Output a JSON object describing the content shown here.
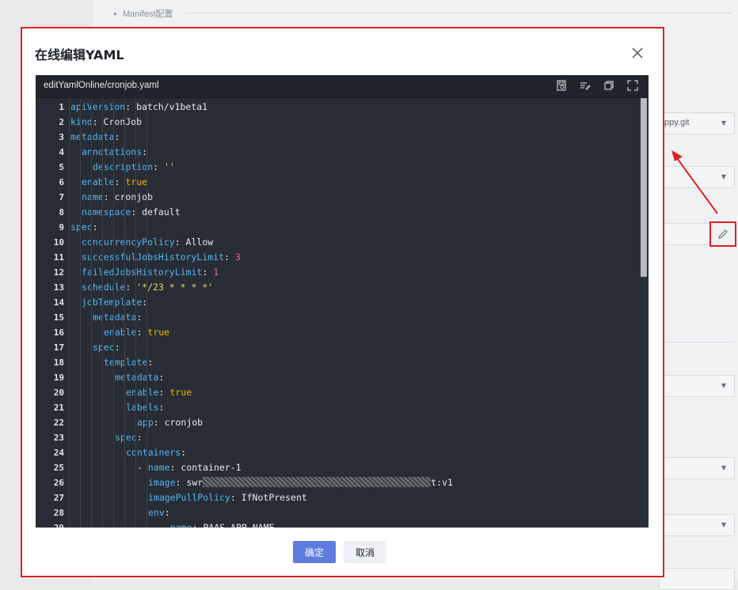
{
  "background": {
    "section_label": "Manifest配置",
    "repo_select_value": "ppy.git"
  },
  "dialog": {
    "title": "在线编辑YAML",
    "editor": {
      "filename": "editYamlOnline/cronjob.yaml",
      "tools": [
        "save-icon",
        "format-icon",
        "copy-icon",
        "fullscreen-icon"
      ],
      "line_numbers": [
        "1",
        "2",
        "3",
        "4",
        "5",
        "6",
        "7",
        "8",
        "9",
        "10",
        "11",
        "12",
        "13",
        "14",
        "15",
        "16",
        "17",
        "18",
        "19",
        "20",
        "21",
        "22",
        "23",
        "24",
        "25",
        "26",
        "27",
        "28",
        "29"
      ],
      "lines": [
        {
          "indent": 0,
          "tokens": [
            {
              "t": "k",
              "v": "apiVersion"
            },
            {
              "t": "p",
              "v": ": batch/v1beta1"
            }
          ]
        },
        {
          "indent": 0,
          "tokens": [
            {
              "t": "k",
              "v": "kind"
            },
            {
              "t": "p",
              "v": ": CronJob"
            }
          ]
        },
        {
          "indent": 0,
          "tokens": [
            {
              "t": "k",
              "v": "metadata"
            },
            {
              "t": "p",
              "v": ":"
            }
          ]
        },
        {
          "indent": 1,
          "tokens": [
            {
              "t": "k",
              "v": "annotations"
            },
            {
              "t": "p",
              "v": ":"
            }
          ]
        },
        {
          "indent": 2,
          "tokens": [
            {
              "t": "k",
              "v": "description"
            },
            {
              "t": "p",
              "v": ": "
            },
            {
              "t": "s",
              "v": "''"
            }
          ]
        },
        {
          "indent": 1,
          "tokens": [
            {
              "t": "k",
              "v": "enable"
            },
            {
              "t": "p",
              "v": ": "
            },
            {
              "t": "b",
              "v": "true"
            }
          ]
        },
        {
          "indent": 1,
          "tokens": [
            {
              "t": "k",
              "v": "name"
            },
            {
              "t": "p",
              "v": ": cronjob"
            }
          ]
        },
        {
          "indent": 1,
          "tokens": [
            {
              "t": "k",
              "v": "namespace"
            },
            {
              "t": "p",
              "v": ": default"
            }
          ]
        },
        {
          "indent": 0,
          "tokens": [
            {
              "t": "k",
              "v": "spec"
            },
            {
              "t": "p",
              "v": ":"
            }
          ]
        },
        {
          "indent": 1,
          "tokens": [
            {
              "t": "k",
              "v": "concurrencyPolicy"
            },
            {
              "t": "p",
              "v": ": Allow"
            }
          ]
        },
        {
          "indent": 1,
          "tokens": [
            {
              "t": "k",
              "v": "successfulJobsHistoryLimit"
            },
            {
              "t": "p",
              "v": ": "
            },
            {
              "t": "n",
              "v": "3"
            }
          ]
        },
        {
          "indent": 1,
          "tokens": [
            {
              "t": "k",
              "v": "failedJobsHistoryLimit"
            },
            {
              "t": "p",
              "v": ": "
            },
            {
              "t": "n",
              "v": "1"
            }
          ]
        },
        {
          "indent": 1,
          "tokens": [
            {
              "t": "k",
              "v": "schedule"
            },
            {
              "t": "p",
              "v": ": "
            },
            {
              "t": "s",
              "v": "'*/23 * * * *'"
            }
          ]
        },
        {
          "indent": 1,
          "tokens": [
            {
              "t": "k",
              "v": "jobTemplate"
            },
            {
              "t": "p",
              "v": ":"
            }
          ]
        },
        {
          "indent": 2,
          "tokens": [
            {
              "t": "k",
              "v": "metadata"
            },
            {
              "t": "p",
              "v": ":"
            }
          ]
        },
        {
          "indent": 3,
          "tokens": [
            {
              "t": "k",
              "v": "enable"
            },
            {
              "t": "p",
              "v": ": "
            },
            {
              "t": "b",
              "v": "true"
            }
          ]
        },
        {
          "indent": 2,
          "tokens": [
            {
              "t": "k",
              "v": "spec"
            },
            {
              "t": "p",
              "v": ":"
            }
          ]
        },
        {
          "indent": 3,
          "tokens": [
            {
              "t": "k",
              "v": "template"
            },
            {
              "t": "p",
              "v": ":"
            }
          ]
        },
        {
          "indent": 4,
          "tokens": [
            {
              "t": "k",
              "v": "metadata"
            },
            {
              "t": "p",
              "v": ":"
            }
          ]
        },
        {
          "indent": 5,
          "tokens": [
            {
              "t": "k",
              "v": "enable"
            },
            {
              "t": "p",
              "v": ": "
            },
            {
              "t": "b",
              "v": "true"
            }
          ]
        },
        {
          "indent": 5,
          "tokens": [
            {
              "t": "k",
              "v": "labels"
            },
            {
              "t": "p",
              "v": ":"
            }
          ]
        },
        {
          "indent": 6,
          "tokens": [
            {
              "t": "k",
              "v": "app"
            },
            {
              "t": "p",
              "v": ": cronjob"
            }
          ]
        },
        {
          "indent": 4,
          "tokens": [
            {
              "t": "k",
              "v": "spec"
            },
            {
              "t": "p",
              "v": ":"
            }
          ]
        },
        {
          "indent": 5,
          "tokens": [
            {
              "t": "k",
              "v": "containers"
            },
            {
              "t": "p",
              "v": ":"
            }
          ]
        },
        {
          "indent": 6,
          "tokens": [
            {
              "t": "p",
              "v": "- "
            },
            {
              "t": "k",
              "v": "name"
            },
            {
              "t": "p",
              "v": ": container-1"
            }
          ]
        },
        {
          "indent": 7,
          "tokens": [
            {
              "t": "k",
              "v": "image"
            },
            {
              "t": "p",
              "v": ": swr"
            },
            {
              "t": "r",
              "v": ""
            },
            {
              "t": "p",
              "v": "t:v1"
            }
          ]
        },
        {
          "indent": 7,
          "tokens": [
            {
              "t": "k",
              "v": "imagePullPolicy"
            },
            {
              "t": "p",
              "v": ": IfNotPresent"
            }
          ]
        },
        {
          "indent": 7,
          "tokens": [
            {
              "t": "k",
              "v": "env"
            },
            {
              "t": "p",
              "v": ":"
            }
          ]
        },
        {
          "indent": 8,
          "tokens": [
            {
              "t": "p",
              "v": "- "
            },
            {
              "t": "k",
              "v": "name"
            },
            {
              "t": "p",
              "v": ": PAAS_APP_NAME"
            }
          ]
        }
      ]
    },
    "confirm_label": "确定",
    "cancel_label": "取消"
  }
}
